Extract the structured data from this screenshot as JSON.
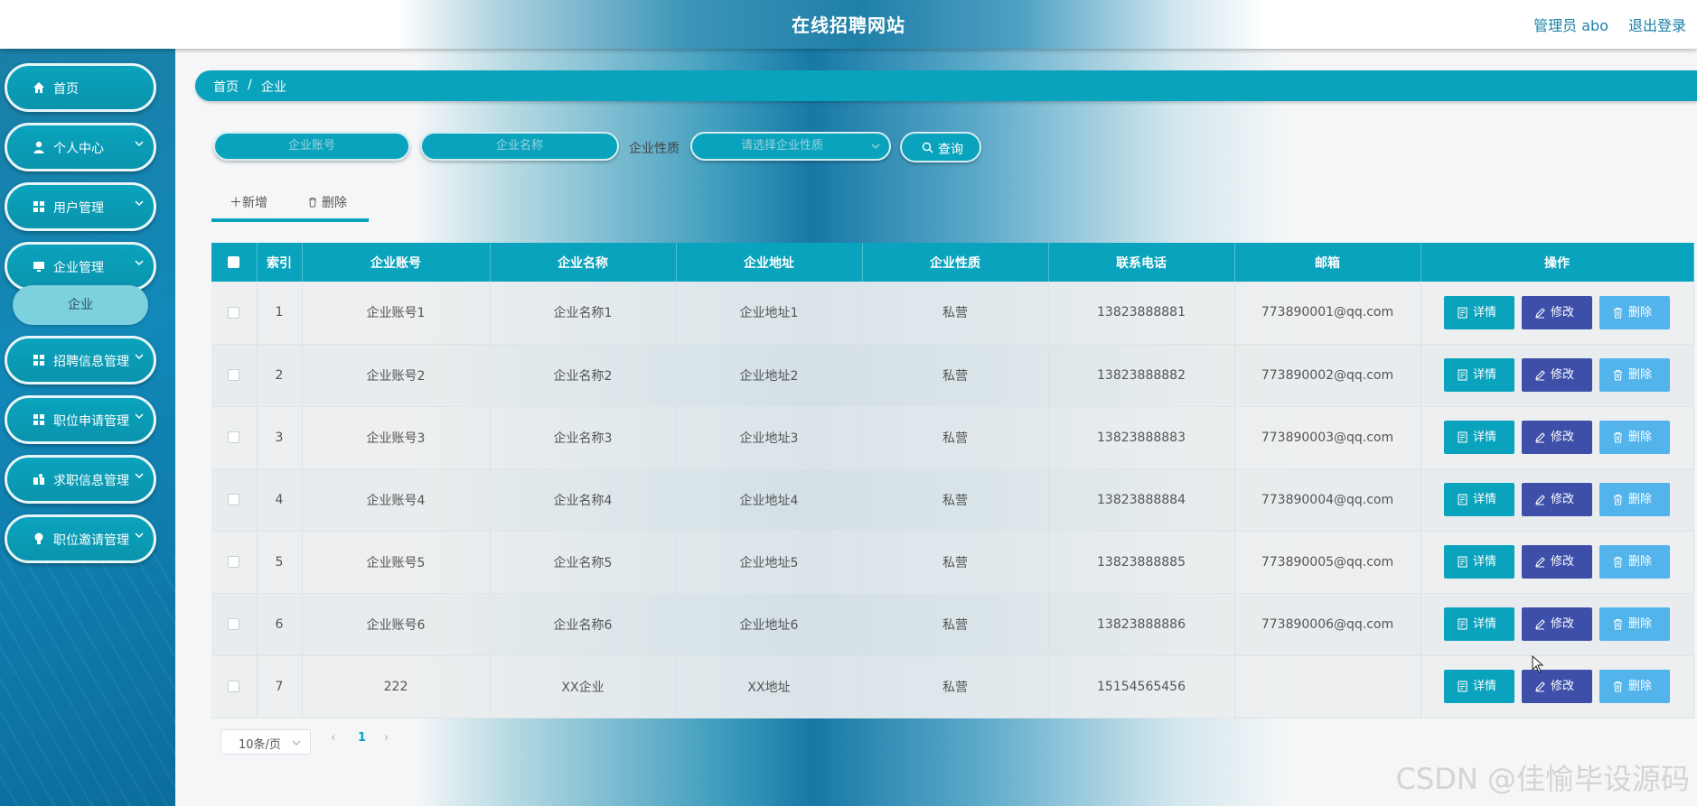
{
  "header": {
    "title": "在线招聘网站",
    "user": "管理员 abo",
    "logout": "退出登录"
  },
  "sidebar": {
    "items": [
      {
        "label": "首页",
        "icon": "home-icon"
      },
      {
        "label": "个人中心",
        "icon": "user-icon"
      },
      {
        "label": "用户管理",
        "icon": "grid-icon"
      },
      {
        "label": "企业管理",
        "icon": "monitor-icon"
      },
      {
        "label": "招聘信息管理",
        "icon": "grid-icon"
      },
      {
        "label": "职位申请管理",
        "icon": "grid-icon"
      },
      {
        "label": "求职信息管理",
        "icon": "gift-icon"
      },
      {
        "label": "职位邀请管理",
        "icon": "bulb-icon"
      }
    ],
    "submenu": {
      "label": "企业"
    }
  },
  "breadcrumb": {
    "home": "首页",
    "sep": "/",
    "current": "企业"
  },
  "search": {
    "account_placeholder": "企业账号",
    "name_placeholder": "企业名称",
    "nature_label": "企业性质",
    "nature_placeholder": "请选择企业性质",
    "query_label": "查询"
  },
  "actions": {
    "add_label": "新增",
    "delete_label": "删除"
  },
  "table": {
    "columns": [
      "索引",
      "企业账号",
      "企业名称",
      "企业地址",
      "企业性质",
      "联系电话",
      "邮箱",
      "操作"
    ],
    "rows": [
      {
        "index": "1",
        "account": "企业账号1",
        "name": "企业名称1",
        "address": "企业地址1",
        "nature": "私营",
        "phone": "13823888881",
        "email": "773890001@qq.com"
      },
      {
        "index": "2",
        "account": "企业账号2",
        "name": "企业名称2",
        "address": "企业地址2",
        "nature": "私营",
        "phone": "13823888882",
        "email": "773890002@qq.com"
      },
      {
        "index": "3",
        "account": "企业账号3",
        "name": "企业名称3",
        "address": "企业地址3",
        "nature": "私营",
        "phone": "13823888883",
        "email": "773890003@qq.com"
      },
      {
        "index": "4",
        "account": "企业账号4",
        "name": "企业名称4",
        "address": "企业地址4",
        "nature": "私营",
        "phone": "13823888884",
        "email": "773890004@qq.com"
      },
      {
        "index": "5",
        "account": "企业账号5",
        "name": "企业名称5",
        "address": "企业地址5",
        "nature": "私营",
        "phone": "13823888885",
        "email": "773890005@qq.com"
      },
      {
        "index": "6",
        "account": "企业账号6",
        "name": "企业名称6",
        "address": "企业地址6",
        "nature": "私营",
        "phone": "13823888886",
        "email": "773890006@qq.com"
      },
      {
        "index": "7",
        "account": "222",
        "name": "XX企业",
        "address": "XX地址",
        "nature": "私营",
        "phone": "15154565456",
        "email": ""
      }
    ],
    "row_actions": {
      "detail": "详情",
      "edit": "修改",
      "delete": "删除"
    }
  },
  "pagination": {
    "page_size": "10条/页",
    "current_page": "1",
    "prev": "‹",
    "next": "›"
  },
  "watermark": "CSDN @佳愉毕设源码",
  "colors": {
    "accent": "#0aa3bd",
    "edit": "#3d4fa8",
    "delete": "#52b4eb",
    "sidebar": "#1a7fa6"
  }
}
